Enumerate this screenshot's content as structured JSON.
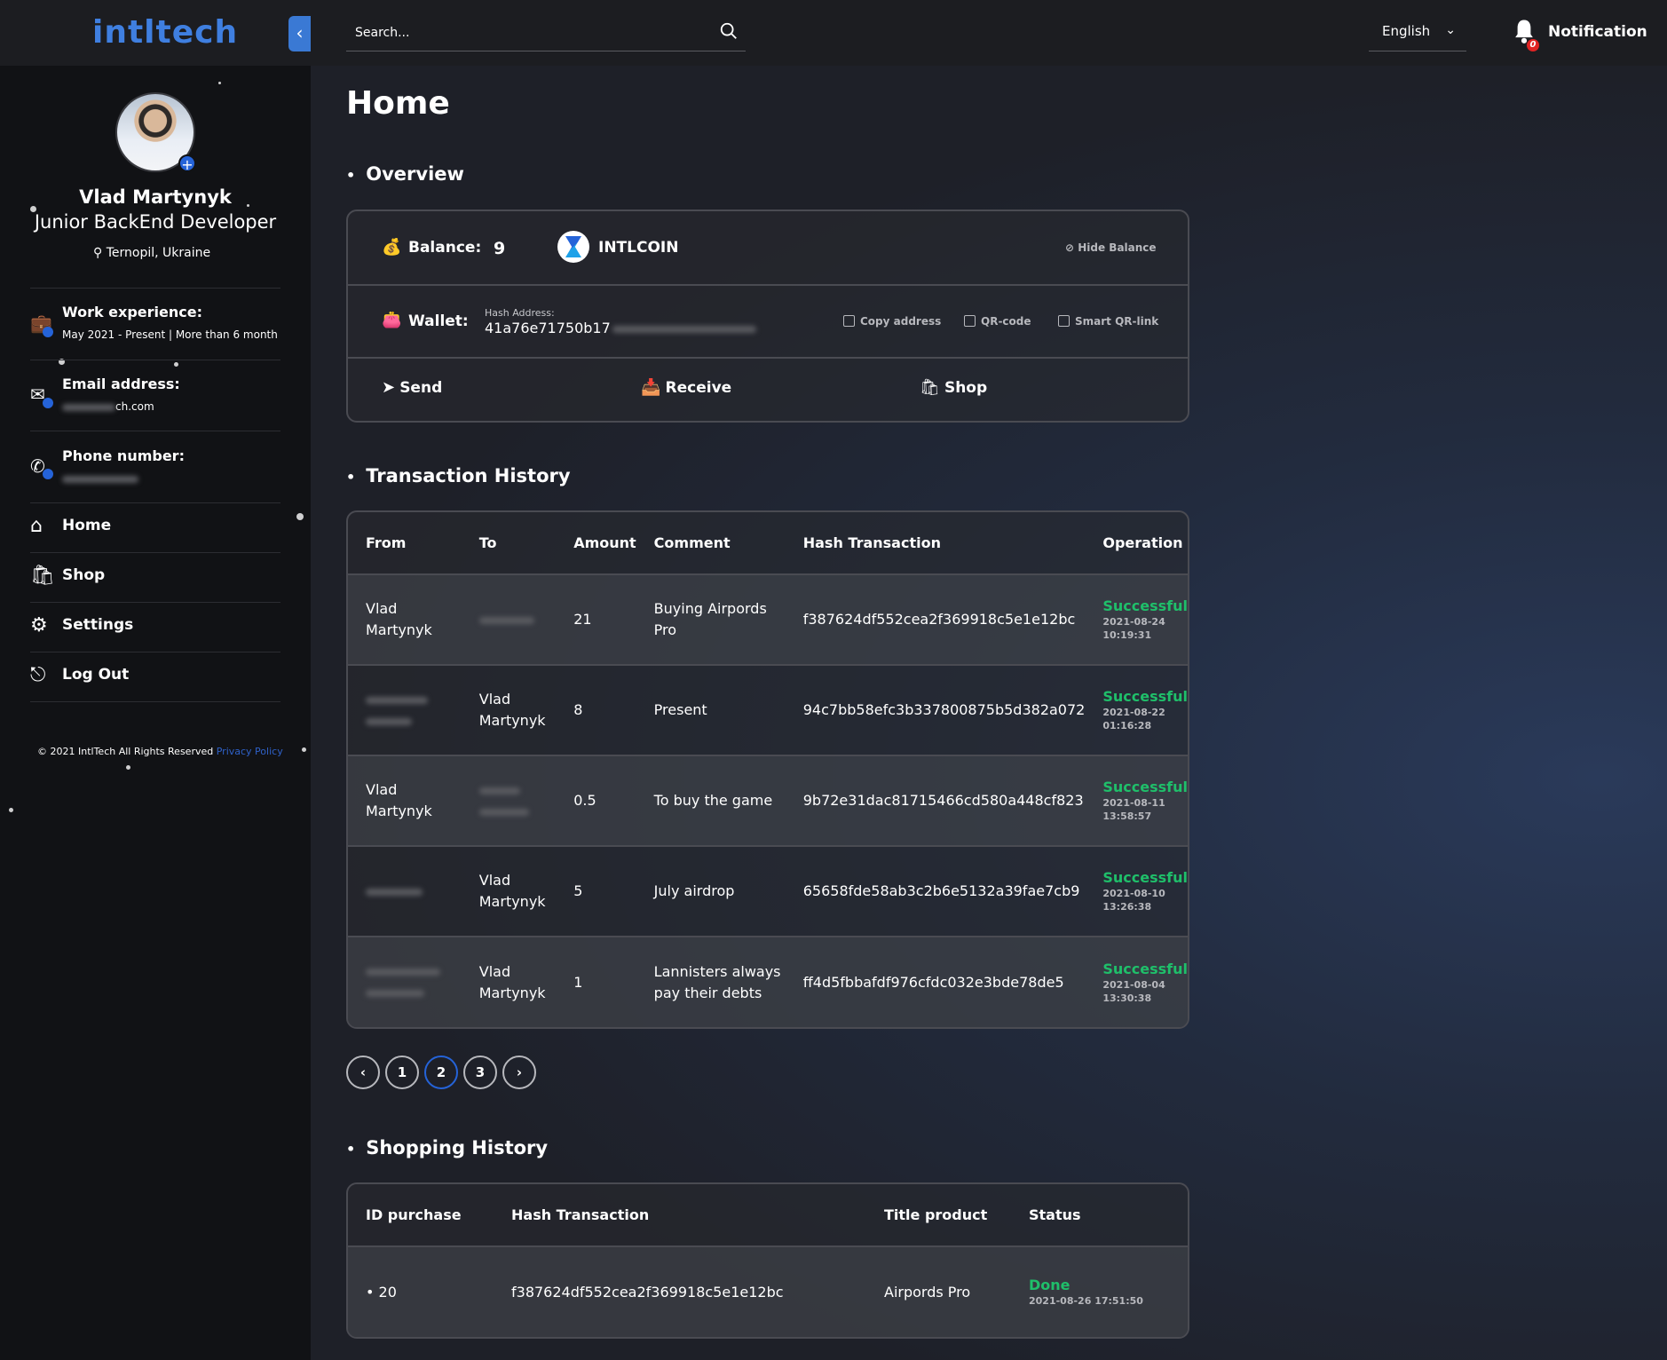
{
  "brand": {
    "logo": "intltech"
  },
  "profile": {
    "name": "Vlad Martynyk",
    "role": "Junior BackEnd Developer",
    "location": "Ternopil, Ukraine",
    "work_title": "Work experience:",
    "work_value": "May 2021 - Present | More than 6 month",
    "email_title": "Email address:",
    "email_value_suffix": "ch.com",
    "phone_title": "Phone number:"
  },
  "sidebar": {
    "items": [
      {
        "label": "Home",
        "icon": "home-icon"
      },
      {
        "label": "Shop",
        "icon": "shop-icon"
      },
      {
        "label": "Settings",
        "icon": "gear-icon"
      },
      {
        "label": "Log Out",
        "icon": "logout-icon"
      }
    ],
    "footer_text": "© 2021 IntlTech All Rights Reserved",
    "footer_link": "Privacy Policy"
  },
  "topbar": {
    "search_placeholder": "Search...",
    "language": "English",
    "notification_label": "Notification",
    "notification_count": "0"
  },
  "page": {
    "title": "Home"
  },
  "overview": {
    "section_title": "Overview",
    "balance_label": "Balance:",
    "balance_value": "9",
    "currency": "INTLCOIN",
    "hide_balance": "Hide Balance",
    "wallet_label": "Wallet:",
    "hash_label": "Hash Address:",
    "hash_value": "41a76e71750b17",
    "copy_address": "Copy address",
    "qr_code": "QR-code",
    "smart_qr": "Smart QR-link",
    "send": "Send",
    "receive": "Receive",
    "shop": "Shop"
  },
  "transactions": {
    "section_title": "Transaction History",
    "headers": [
      "From",
      "To",
      "Amount",
      "Comment",
      "Hash Transaction",
      "Operation"
    ],
    "rows": [
      {
        "from": "Vlad Martynyk",
        "to": "",
        "amount": "21",
        "comment": "Buying Airpords Pro",
        "hash": "f387624df552cea2f369918c5e1e12bc",
        "status": "Successful",
        "date": "2021-08-24",
        "time": "10:19:31"
      },
      {
        "from": "",
        "to": "Vlad Martynyk",
        "amount": "8",
        "comment": "Present",
        "hash": "94c7bb58efc3b337800875b5d382a072",
        "status": "Successful",
        "date": "2021-08-22",
        "time": "01:16:28"
      },
      {
        "from": "Vlad Martynyk",
        "to": "",
        "amount": "0.5",
        "comment": "To buy the game",
        "hash": "9b72e31dac81715466cd580a448cf823",
        "status": "Successful",
        "date": "2021-08-11",
        "time": "13:58:57"
      },
      {
        "from": "",
        "to": "Vlad Martynyk",
        "amount": "5",
        "comment": "July airdrop",
        "hash": "65658fde58ab3c2b6e5132a39fae7cb9",
        "status": "Successful",
        "date": "2021-08-10",
        "time": "13:26:38"
      },
      {
        "from": "",
        "to": "Vlad Martynyk",
        "amount": "1",
        "comment": "Lannisters always pay their debts",
        "hash": "ff4d5fbbafdf976cfdc032e3bde78de5",
        "status": "Successful",
        "date": "2021-08-04",
        "time": "13:30:38"
      }
    ],
    "pagination": {
      "prev": "‹",
      "pages": [
        "1",
        "2",
        "3"
      ],
      "active": "2",
      "next": "›"
    }
  },
  "shopping": {
    "section_title": "Shopping History",
    "headers": [
      "ID purchase",
      "Hash Transaction",
      "Title product",
      "Status"
    ],
    "rows": [
      {
        "id": "20",
        "hash": "f387624df552cea2f369918c5e1e12bc",
        "title": "Airpords Pro",
        "status": "Done",
        "datetime": "2021-08-26 17:51:50"
      }
    ]
  },
  "colors": {
    "accent": "#2563d8",
    "success": "#1fbf6a",
    "badge": "#e02323"
  }
}
